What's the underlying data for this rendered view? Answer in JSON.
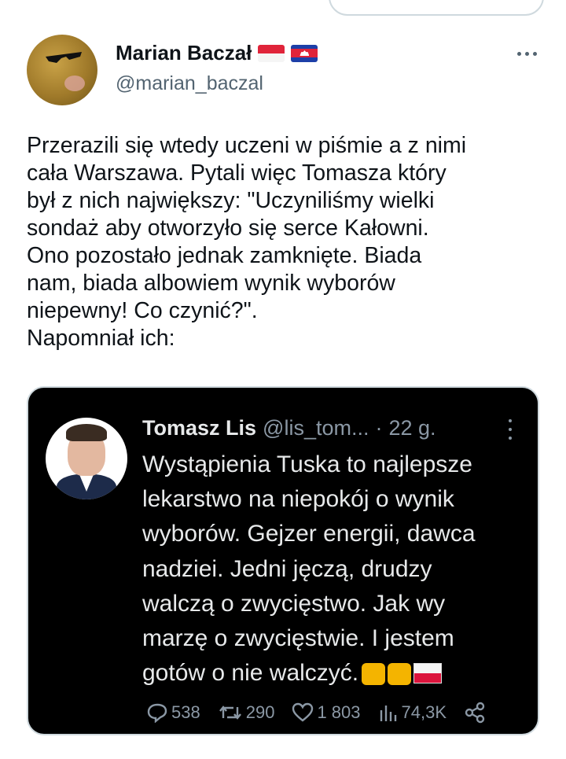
{
  "author": {
    "name": "Marian Baczał",
    "handle": "@marian_baczal",
    "flags": [
      "flag-indonesia-icon",
      "flag-cambodia-icon"
    ]
  },
  "tweet": {
    "text": "Przerazili się wtedy uczeni w piśmie a z nimi\ncała Warszawa. Pytali więc Tomasza który\nbył z nich największy: \"Uczyniliśmy wielki\nsondaż aby otworzyło się serce Kałowni.\nOno pozostało jednak zamknięte. Biada\nnam, biada albowiem wynik wyborów\nniepewny! Co czynić?\".\nNapomniał ich:"
  },
  "embedded": {
    "name": "Tomasz Lis",
    "handle": "@lis_tom...",
    "separator": "·",
    "time": "22 g.",
    "text": "Wystąpienia Tuska to najlepsze\nlekarstwo na niepokój o wynik\nwyborów. Gejzer energii, dawca\nnadziei. Jedni jęczą, drudzy\nwalczą o zwycięstwo. Jak wy\nmarzę o zwycięstwie. I jestem\ngotów o nie walczyć.",
    "emojis": [
      "flexed-biceps-icon",
      "thumbs-up-icon",
      "flag-poland-icon"
    ],
    "stats": {
      "replies": "538",
      "reposts": "290",
      "likes": "1 803",
      "views": "74,3K"
    }
  },
  "colors": {
    "text_primary": "#0f1419",
    "text_secondary": "#536471",
    "embed_bg": "#000000",
    "embed_text": "#e7e9ea",
    "embed_muted": "#8b98a5",
    "border": "#cfd9de"
  }
}
